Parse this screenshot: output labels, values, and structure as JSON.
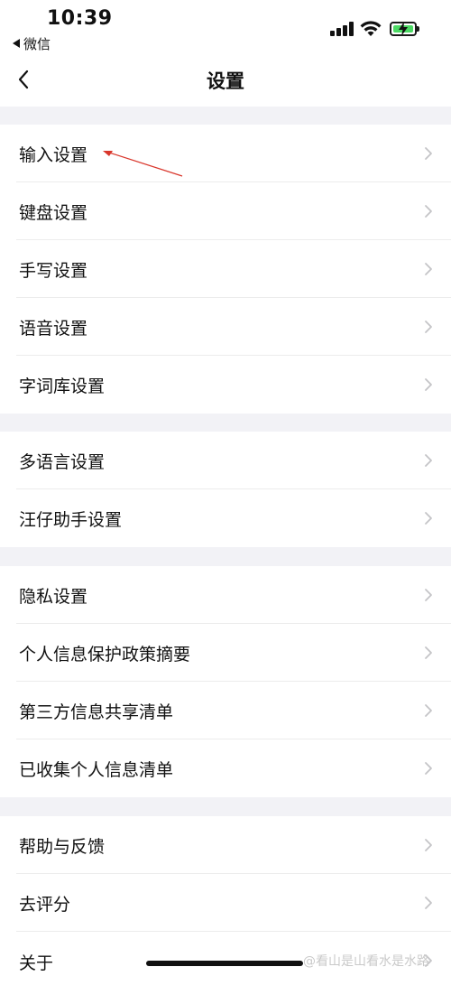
{
  "status_bar": {
    "time": "10:39",
    "back_app": "微信"
  },
  "nav": {
    "title": "设置",
    "back_icon": "chevron-left-icon"
  },
  "groups": [
    {
      "items": [
        {
          "label": "输入设置"
        },
        {
          "label": "键盘设置"
        },
        {
          "label": "手写设置"
        },
        {
          "label": "语音设置"
        },
        {
          "label": "字词库设置"
        }
      ]
    },
    {
      "items": [
        {
          "label": "多语言设置"
        },
        {
          "label": "汪仔助手设置"
        }
      ]
    },
    {
      "items": [
        {
          "label": "隐私设置"
        },
        {
          "label": "个人信息保护政策摘要"
        },
        {
          "label": "第三方信息共享清单"
        },
        {
          "label": "已收集个人信息清单"
        }
      ]
    },
    {
      "items": [
        {
          "label": "帮助与反馈"
        },
        {
          "label": "去评分"
        },
        {
          "label": "关于"
        }
      ]
    }
  ],
  "watermark": "@看山是山看水是水路",
  "colors": {
    "background": "#f2f2f6",
    "surface": "#ffffff",
    "divider": "#ececec",
    "chevron": "#c4c4c7",
    "annotation": "#d9362b",
    "battery": "#4cd964"
  }
}
